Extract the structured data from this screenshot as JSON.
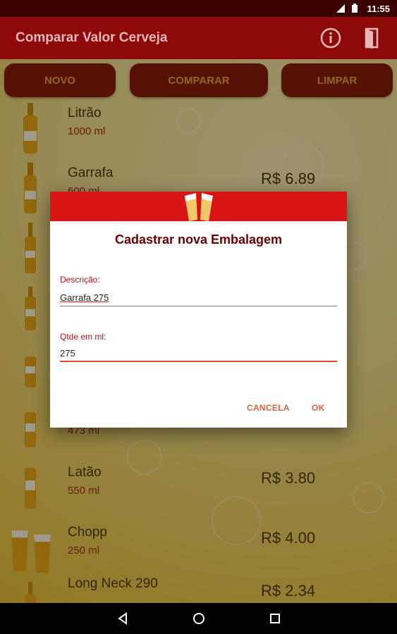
{
  "status": {
    "time": "11:55"
  },
  "app": {
    "title": "Comparar Valor Cerveja"
  },
  "buttons": {
    "novo": "NOVO",
    "comparar": "COMPARAR",
    "limpar": "LIMPAR"
  },
  "list": [
    {
      "name": "Litrão",
      "volume": "1000 ml",
      "price": ""
    },
    {
      "name": "Garrafa",
      "volume": "600 ml",
      "price": "R$ 6.89"
    },
    {
      "name": "",
      "volume": "",
      "price": ""
    },
    {
      "name": "",
      "volume": "",
      "price": ""
    },
    {
      "name": "",
      "volume": "",
      "price": ""
    },
    {
      "name": "",
      "volume": "473 ml",
      "price": ""
    },
    {
      "name": "Latão",
      "volume": "550 ml",
      "price": "R$ 3.80"
    },
    {
      "name": "Chopp",
      "volume": "250 ml",
      "price": "R$ 4.00"
    },
    {
      "name": "Long Neck 290",
      "volume": "",
      "price": "R$ 2.34"
    }
  ],
  "dialog": {
    "title": "Cadastrar nova Embalagem",
    "description_label": "Descrição:",
    "description_value": "Garrafa 275",
    "qty_label": "Qtde em ml:",
    "qty_value": "275",
    "cancel_label": "CANCELA",
    "ok_label": "OK"
  },
  "colors": {
    "primary": "#8e0a0a",
    "accent": "#d81414",
    "button_text": "#e6a338"
  },
  "icons": {
    "info": "info-icon",
    "exit": "exit-door-icon",
    "back": "back-icon",
    "home": "home-icon",
    "recents": "recents-icon"
  }
}
